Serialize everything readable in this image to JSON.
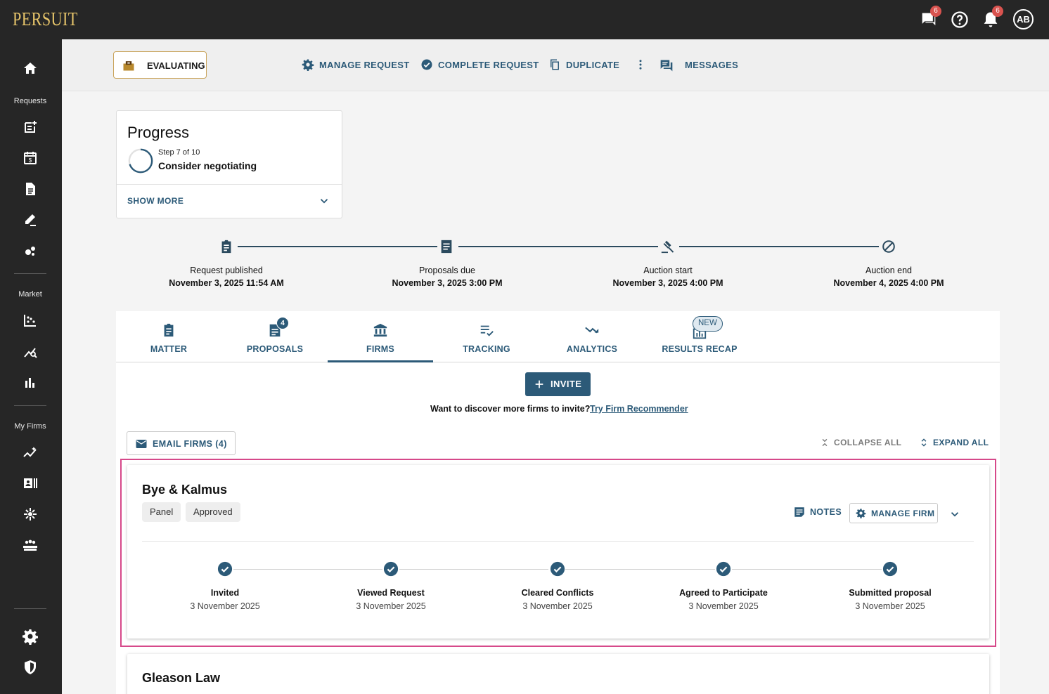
{
  "app": {
    "logo": "PERSUIT",
    "avatar_initials": "AB",
    "messages_badge": "6",
    "notifications_badge": "6"
  },
  "sidebar": {
    "section_requests": "Requests",
    "section_market": "Market",
    "section_my_firms": "My Firms"
  },
  "actionbar": {
    "status": "EVALUATING",
    "manage_request": "MANAGE REQUEST",
    "complete_request": "COMPLETE REQUEST",
    "duplicate": "DUPLICATE",
    "messages": "MESSAGES"
  },
  "progress": {
    "title": "Progress",
    "step_text": "Step 7 of 10",
    "step_name": "Consider negotiating",
    "step_fraction": 0.7,
    "show_more": "SHOW MORE"
  },
  "timeline": [
    {
      "label": "Request published",
      "date": "November 3, 2025 11:54 AM",
      "icon": "clipboard-icon"
    },
    {
      "label": "Proposals due",
      "date": "November 3, 2025 3:00 PM",
      "icon": "document-icon"
    },
    {
      "label": "Auction start",
      "date": "November 3, 2025 4:00 PM",
      "icon": "gavel-icon"
    },
    {
      "label": "Auction end",
      "date": "November 4, 2025 4:00 PM",
      "icon": "blocked-icon"
    }
  ],
  "tabs": [
    {
      "label": "MATTER"
    },
    {
      "label": "PROPOSALS",
      "badge": "4"
    },
    {
      "label": "FIRMS",
      "active": true
    },
    {
      "label": "TRACKING"
    },
    {
      "label": "ANALYTICS"
    },
    {
      "label": "RESULTS RECAP",
      "badge": "NEW"
    }
  ],
  "firms_panel": {
    "invite": "INVITE",
    "discover_text": "Want to discover more firms to invite?",
    "discover_link": "Try Firm Recommender",
    "email_firms": "EMAIL FIRMS (4)",
    "collapse_all": "COLLAPSE ALL",
    "expand_all": "EXPAND ALL"
  },
  "firms": [
    {
      "name": "Bye & Kalmus",
      "tags": [
        "Panel",
        "Approved"
      ],
      "notes": "NOTES",
      "manage": "MANAGE FIRM",
      "stages": [
        {
          "label": "Invited",
          "date": "3 November 2025"
        },
        {
          "label": "Viewed Request",
          "date": "3 November 2025"
        },
        {
          "label": "Cleared Conflicts",
          "date": "3 November 2025"
        },
        {
          "label": "Agreed to Participate",
          "date": "3 November 2025"
        },
        {
          "label": "Submitted proposal",
          "date": "3 November 2025"
        }
      ]
    },
    {
      "name": "Gleason Law"
    }
  ],
  "colors": {
    "accent": "#2c5a78",
    "highlight": "#d6498a",
    "logo": "#e6c46a",
    "badge": "#d9534f"
  }
}
